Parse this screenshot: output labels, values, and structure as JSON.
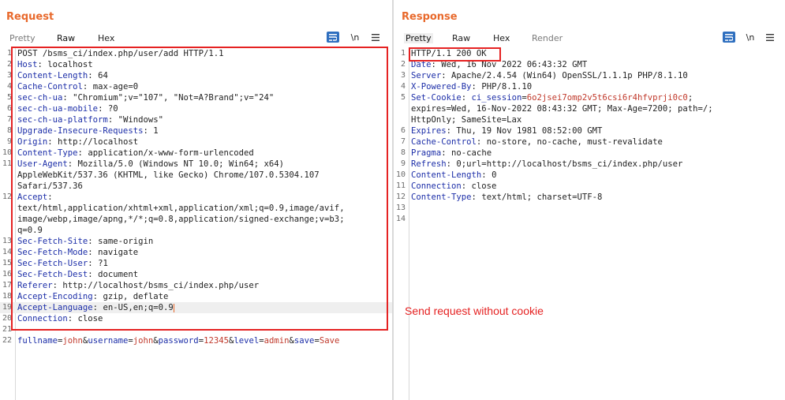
{
  "request": {
    "title": "Request",
    "tabs": [
      "Pretty",
      "Raw",
      "Hex"
    ],
    "selected_tab": "Raw",
    "wrap_label": "\\n",
    "lines": [
      {
        "n": "1",
        "text": "POST /bsms_ci/index.php/user/add HTTP/1.1"
      },
      {
        "n": "2",
        "key": "Host",
        "val": "localhost"
      },
      {
        "n": "3",
        "key": "Content-Length",
        "val": "64"
      },
      {
        "n": "4",
        "key": "Cache-Control",
        "val": "max-age=0"
      },
      {
        "n": "5",
        "key": "sec-ch-ua",
        "val": "\"Chromium\";v=\"107\", \"Not=A?Brand\";v=\"24\""
      },
      {
        "n": "6",
        "key": "sec-ch-ua-mobile",
        "val": "?0"
      },
      {
        "n": "7",
        "key": "sec-ch-ua-platform",
        "val": "\"Windows\""
      },
      {
        "n": "8",
        "key": "Upgrade-Insecure-Requests",
        "val": "1"
      },
      {
        "n": "9",
        "key": "Origin",
        "val": "http://localhost"
      },
      {
        "n": "10",
        "key": "Content-Type",
        "val": "application/x-www-form-urlencoded"
      },
      {
        "n": "11",
        "key": "User-Agent",
        "val": "Mozilla/5.0 (Windows NT 10.0; Win64; x64)"
      },
      {
        "n": "",
        "text": "AppleWebKit/537.36 (KHTML, like Gecko) Chrome/107.0.5304.107"
      },
      {
        "n": "",
        "text": "Safari/537.36"
      },
      {
        "n": "12",
        "key": "Accept",
        "val": ""
      },
      {
        "n": "",
        "text": "text/html,application/xhtml+xml,application/xml;q=0.9,image/avif,"
      },
      {
        "n": "",
        "text": "image/webp,image/apng,*/*;q=0.8,application/signed-exchange;v=b3;"
      },
      {
        "n": "",
        "text": "q=0.9"
      },
      {
        "n": "13",
        "key": "Sec-Fetch-Site",
        "val": "same-origin"
      },
      {
        "n": "14",
        "key": "Sec-Fetch-Mode",
        "val": "navigate"
      },
      {
        "n": "15",
        "key": "Sec-Fetch-User",
        "val": "?1"
      },
      {
        "n": "16",
        "key": "Sec-Fetch-Dest",
        "val": "document"
      },
      {
        "n": "17",
        "key": "Referer",
        "val": "http://localhost/bsms_ci/index.php/user"
      },
      {
        "n": "18",
        "key": "Accept-Encoding",
        "val": "gzip, deflate"
      },
      {
        "n": "19",
        "key": "Accept-Language",
        "val": "en-US,en;q=0.9",
        "cursor": true
      },
      {
        "n": "20",
        "key": "Connection",
        "val": "close"
      },
      {
        "n": "21",
        "text": ""
      }
    ],
    "body_line": {
      "n": "22",
      "params": [
        {
          "k": "fullname",
          "v": "john"
        },
        {
          "k": "username",
          "v": "john"
        },
        {
          "k": "password",
          "v": "12345"
        },
        {
          "k": "level",
          "v": "admin"
        },
        {
          "k": "save",
          "v": "Save"
        }
      ]
    }
  },
  "response": {
    "title": "Response",
    "tabs": [
      "Pretty",
      "Raw",
      "Hex",
      "Render"
    ],
    "selected_tab": "Pretty",
    "wrap_label": "\\n",
    "lines": [
      {
        "n": "1",
        "text": "HTTP/1.1 200 OK"
      },
      {
        "n": "2",
        "key": "Date",
        "val": "Wed, 16 Nov 2022 06:43:32 GMT"
      },
      {
        "n": "3",
        "key": "Server",
        "val": "Apache/2.4.54 (Win64) OpenSSL/1.1.1p PHP/8.1.10"
      },
      {
        "n": "4",
        "key": "X-Powered-By",
        "val": "PHP/8.1.10"
      },
      {
        "n": "5",
        "key": "Set-Cookie",
        "cookie_name": "ci_session",
        "cookie_val": "6o2jsei7omp2v5t6csi6r4hfvprji0c0",
        "val": ";"
      },
      {
        "n": "",
        "text": "expires=Wed, 16-Nov-2022 08:43:32 GMT; Max-Age=7200; path=/;"
      },
      {
        "n": "",
        "text": "HttpOnly; SameSite=Lax"
      },
      {
        "n": "6",
        "key": "Expires",
        "val": "Thu, 19 Nov 1981 08:52:00 GMT"
      },
      {
        "n": "7",
        "key": "Cache-Control",
        "val": "no-store, no-cache, must-revalidate"
      },
      {
        "n": "8",
        "key": "Pragma",
        "val": "no-cache"
      },
      {
        "n": "9",
        "key": "Refresh",
        "val": "0;url=http://localhost/bsms_ci/index.php/user"
      },
      {
        "n": "10",
        "key": "Content-Length",
        "val": "0"
      },
      {
        "n": "11",
        "key": "Connection",
        "val": "close"
      },
      {
        "n": "12",
        "key": "Content-Type",
        "val": "text/html; charset=UTF-8"
      },
      {
        "n": "13",
        "text": ""
      },
      {
        "n": "14",
        "text": ""
      }
    ]
  },
  "annotation": {
    "note": "Send request without cookie",
    "color": "#e52222"
  },
  "colors": {
    "accent": "#e8692c",
    "header_key": "#1c2ea8",
    "param_value": "#c0392b",
    "active_button": "#2f6fbf"
  },
  "icons": {
    "wrap": "wrap-lines-icon",
    "menu": "hamburger-menu-icon",
    "layout": [
      "split-columns-icon",
      "split-rows-icon",
      "single-pane-icon"
    ]
  }
}
